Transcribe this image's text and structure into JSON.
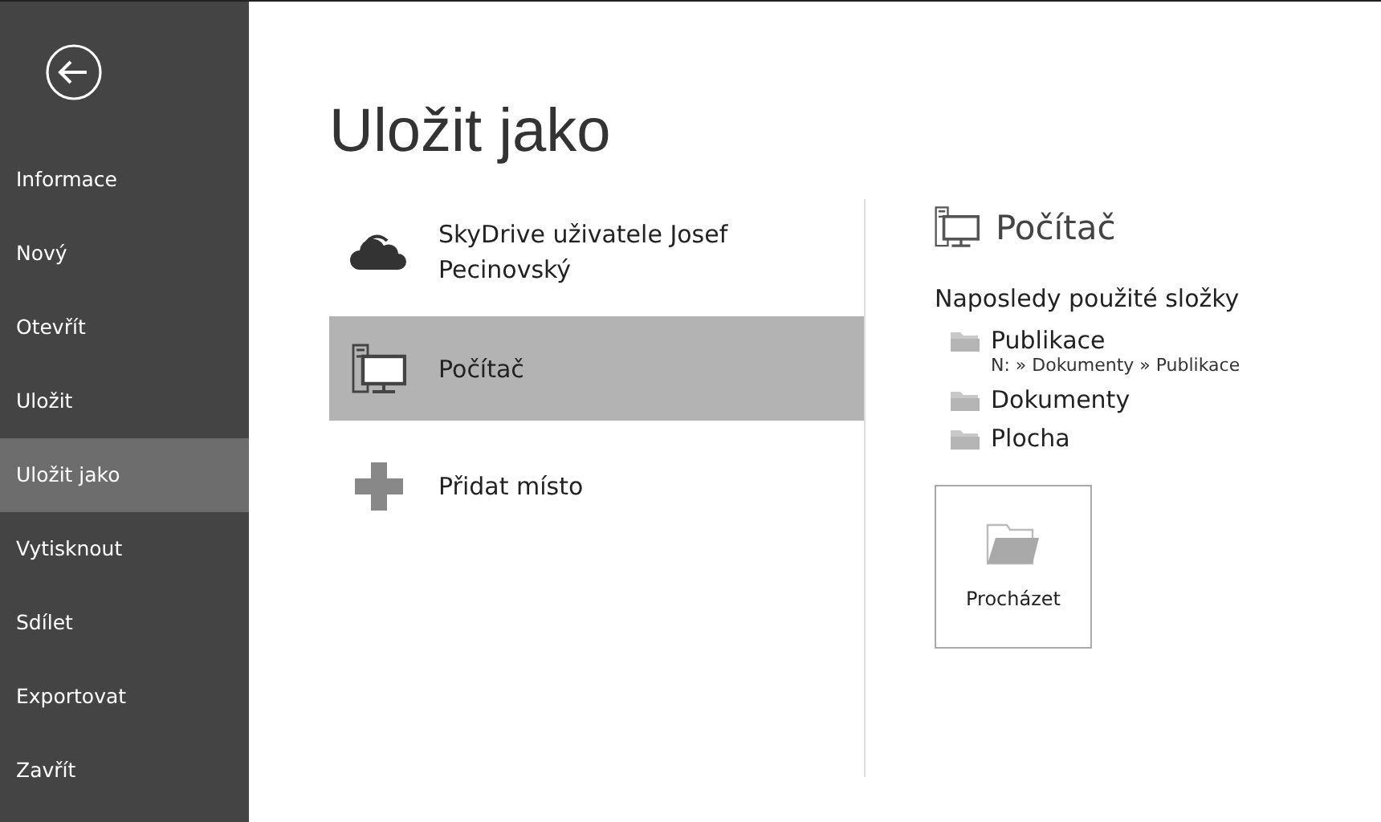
{
  "sidebar": {
    "items": [
      {
        "label": "Informace",
        "selected": false
      },
      {
        "label": "Nový",
        "selected": false
      },
      {
        "label": "Otevřít",
        "selected": false
      },
      {
        "label": "Uložit",
        "selected": false
      },
      {
        "label": "Uložit jako",
        "selected": true
      },
      {
        "label": "Vytisknout",
        "selected": false
      },
      {
        "label": "Sdílet",
        "selected": false
      },
      {
        "label": "Exportovat",
        "selected": false
      },
      {
        "label": "Zavřít",
        "selected": false
      }
    ]
  },
  "title": "Uložit jako",
  "places": [
    {
      "kind": "cloud",
      "label": "SkyDrive uživatele Josef Pecinovský",
      "selected": false
    },
    {
      "kind": "computer",
      "label": "Počítač",
      "selected": true
    },
    {
      "kind": "add",
      "label": "Přidat místo",
      "selected": false
    }
  ],
  "detail": {
    "title": "Počítač",
    "recent_heading": "Naposledy použité složky",
    "folders": [
      {
        "name": "Publikace",
        "path": "N: » Dokumenty » Publikace"
      },
      {
        "name": "Dokumenty"
      },
      {
        "name": "Plocha"
      }
    ],
    "browse_button": "Procházet"
  }
}
